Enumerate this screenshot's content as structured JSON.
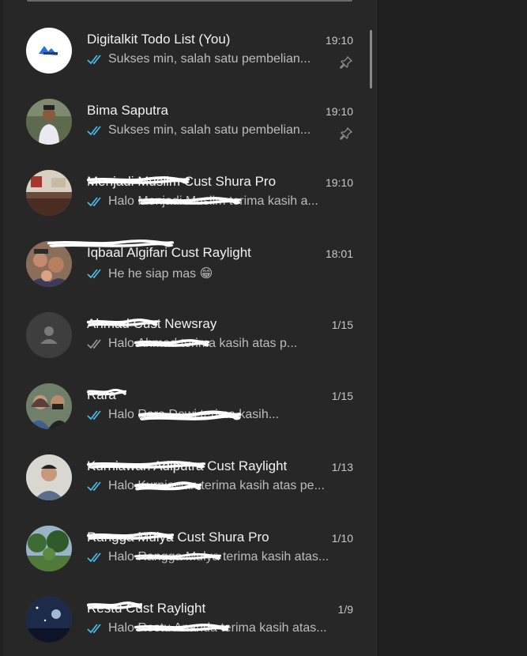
{
  "chats": [
    {
      "name": "Digitalkit Todo List (You)",
      "time": "19:10",
      "preview": "Sukses min, salah satu pembelian...",
      "read": true,
      "pinned": true,
      "avatar": "digitalkit-logo"
    },
    {
      "name": "Bima Saputra",
      "time": "19:10",
      "preview": "Sukses min, salah satu pembelian...",
      "read": true,
      "pinned": true,
      "avatar": "photo-person"
    },
    {
      "name": "Menjadi Muslim Cust Shura Pro",
      "time": "19:10",
      "preview": "Halo Menjadi Muslim terima kasih a...",
      "read": true,
      "pinned": false,
      "avatar": "photo-room"
    },
    {
      "name": "Iqbaal Algifari Cust Raylight",
      "time": "18:01",
      "preview": "He he siap mas 😁",
      "read": true,
      "pinned": false,
      "avatar": "photo-group"
    },
    {
      "name": "Ahmad Cust Newsray",
      "time": "1/15",
      "preview": "Halo Ahmad terima kasih atas p...",
      "read": false,
      "pinned": false,
      "avatar": "default-avatar"
    },
    {
      "name": "Rara",
      "time": "1/15",
      "preview": "Halo Rara Dewi terima kasih...",
      "read": true,
      "pinned": false,
      "avatar": "photo-couple"
    },
    {
      "name": "Kurniawan Adiputra Cust Raylight",
      "time": "1/13",
      "preview": "Halo Kurniawan terima kasih atas pe...",
      "read": true,
      "pinned": false,
      "avatar": "photo-man"
    },
    {
      "name": "Rangga Mulya Cust Shura Pro",
      "time": "1/10",
      "preview": "Halo Rangga Mulya terima kasih atas...",
      "read": true,
      "pinned": false,
      "avatar": "photo-trees"
    },
    {
      "name": "Restu Cust Raylight",
      "time": "1/9",
      "preview": "Halo Restu Ananda terima kasih atas...",
      "read": true,
      "pinned": false,
      "avatar": "photo-night"
    }
  ],
  "colors": {
    "read_tick": "#53bdeb",
    "unread_tick": "#9a9a9a",
    "pane": "#272727"
  }
}
